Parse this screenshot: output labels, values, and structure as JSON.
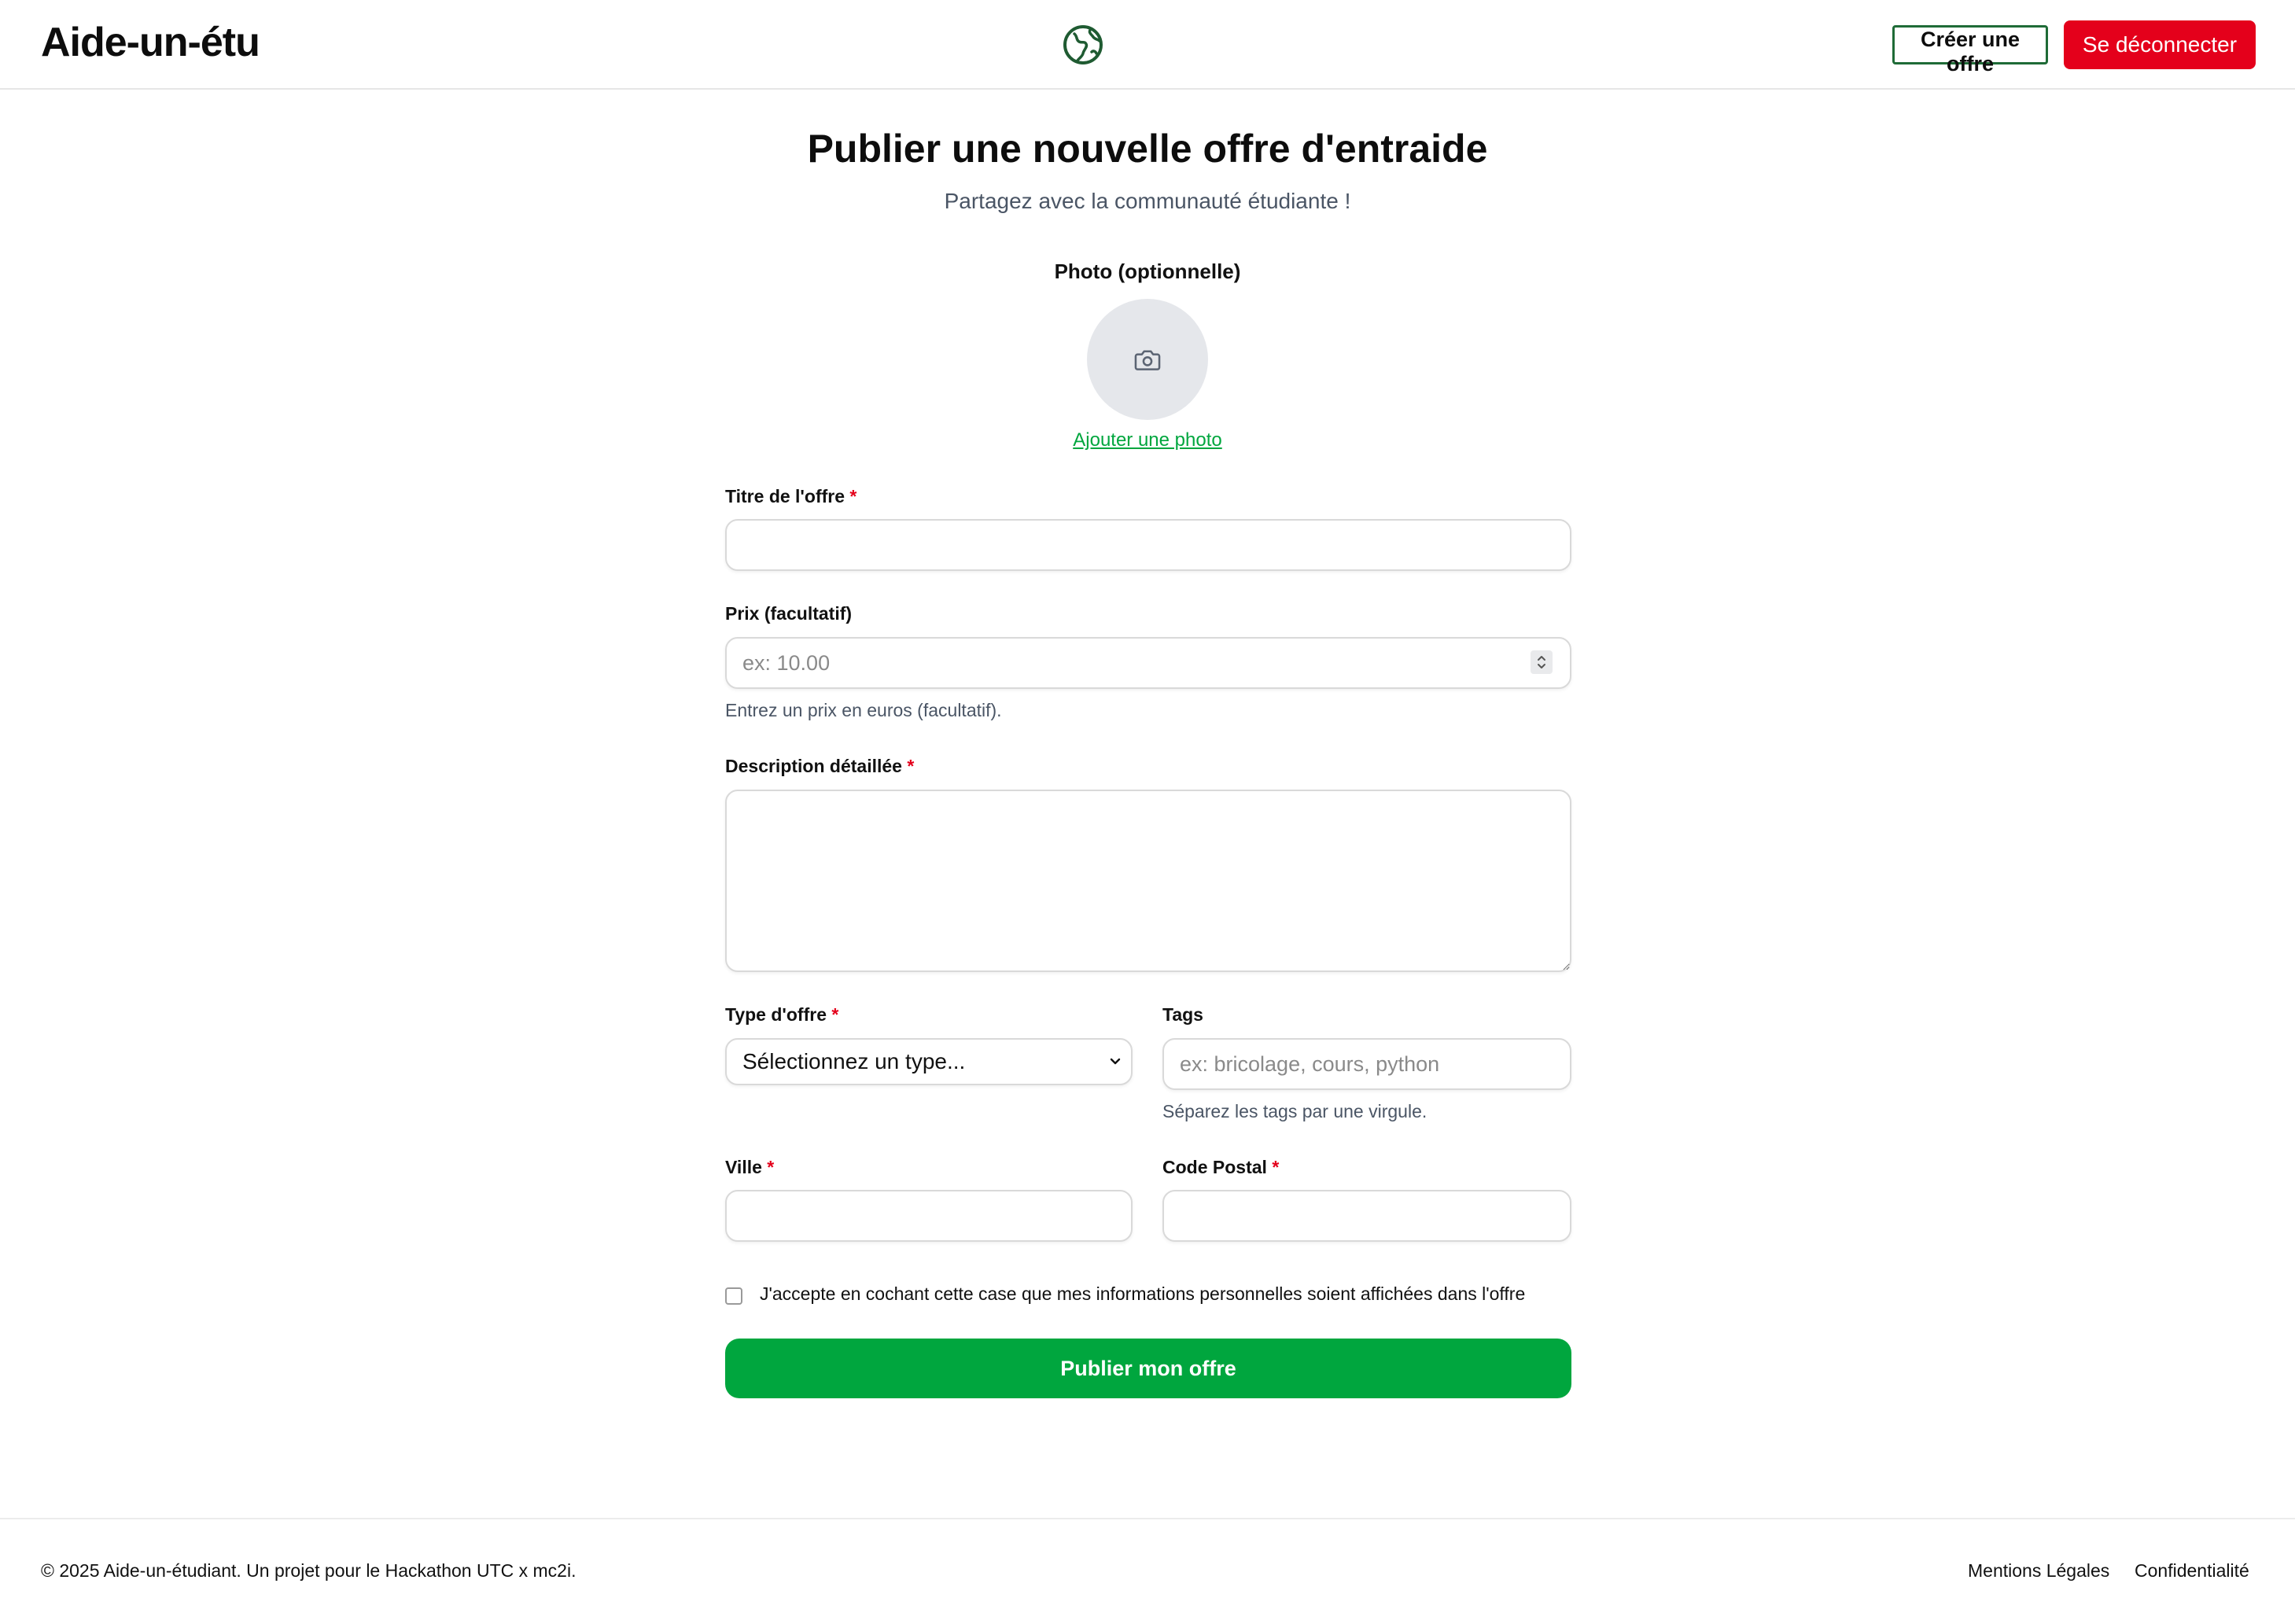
{
  "header": {
    "brand": "Aide-un-étu",
    "logo_icon": "globe-icon",
    "create_offer": "Créer une offre",
    "logout": "Se déconnecter",
    "colors": {
      "logout_bg": "#e4001b",
      "create_border": "#1f6b37"
    }
  },
  "main": {
    "title": "Publier une nouvelle offre d'entraide",
    "subtitle": "Partagez avec la communauté étudiante !",
    "photo": {
      "label": "Photo (optionnelle)",
      "icon": "camera-icon",
      "add_link": "Ajouter une photo"
    },
    "form": {
      "title": {
        "label": "Titre de l'offre",
        "required": "*",
        "value": ""
      },
      "price": {
        "label": "Prix (facultatif)",
        "placeholder": "ex: 10.00",
        "value": "",
        "help": "Entrez un prix en euros (facultatif)."
      },
      "description": {
        "label": "Description détaillée",
        "required": "*",
        "value": ""
      },
      "type": {
        "label": "Type d'offre",
        "required": "*",
        "selected": "Sélectionnez un type..."
      },
      "tags": {
        "label": "Tags",
        "placeholder": "ex: bricolage, cours, python",
        "value": "",
        "help": "Séparez les tags par une virgule."
      },
      "city": {
        "label": "Ville",
        "required": "*",
        "value": ""
      },
      "postal": {
        "label": "Code Postal",
        "required": "*",
        "value": ""
      },
      "consent": "J'accepte en cochant cette case que mes informations personnelles soient affichées dans l'offre",
      "submit": "Publier mon offre"
    },
    "colors": {
      "accent": "#00a63e",
      "required": "#e4001b"
    }
  },
  "footer": {
    "copyright": "© 2025 Aide-un-étudiant. Un projet pour le Hackathon UTC x mc2i.",
    "links": [
      "Mentions Légales",
      "Confidentialité"
    ]
  }
}
